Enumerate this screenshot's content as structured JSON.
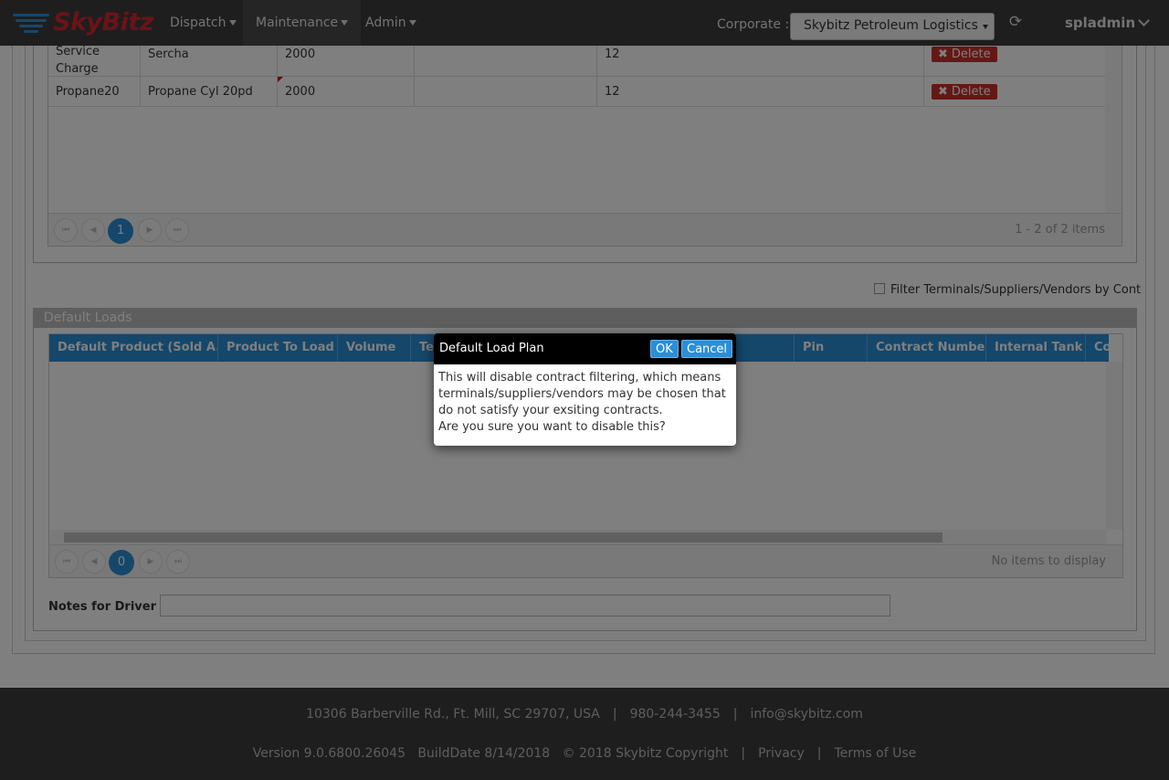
{
  "nav": {
    "logo": "SkyBitz",
    "menus": [
      {
        "label": "Dispatch"
      },
      {
        "label": "Maintenance"
      },
      {
        "label": "Admin"
      }
    ],
    "corporate_label": "Corporate :",
    "corporate_value": "Skybitz Petroleum Logistics",
    "user": "spladmin",
    "icons": {
      "refresh": "refresh-icon",
      "user_menu": "chevron-down-icon"
    }
  },
  "products_grid": {
    "rows": [
      {
        "code": "Service Charge",
        "name": "Sercha",
        "volume": "2000",
        "col4": "",
        "col5": "12",
        "action": "Delete"
      },
      {
        "code": "Propane20",
        "name": "Propane Cyl 20pd",
        "volume": "2000",
        "col4": "",
        "col5": "12",
        "action": "Delete"
      }
    ],
    "pager": {
      "page": "1",
      "info": "1 - 2 of 2 items"
    }
  },
  "filter": {
    "label": "Filter Terminals/Suppliers/Vendors by Cont",
    "checked": false
  },
  "default_loads": {
    "title": "Default Loads",
    "columns": [
      "Default Product (Sold A...",
      "Product To Load",
      "Volume",
      "Te",
      "Pin",
      "Contract Number",
      "Internal Tank",
      "Co"
    ],
    "pager": {
      "page": "0",
      "info": "No items to display"
    },
    "notes_label": "Notes for Driver",
    "notes_value": ""
  },
  "footer": {
    "address": "10306 Barberville Rd., Ft. Mill, SC 29707, USA",
    "phone": "980-244-3455",
    "email": "info@skybitz.com",
    "version": "Version 9.0.6800.26045",
    "build": "BuildDate 8/14/2018",
    "copyright": "© 2018 Skybitz Copyright",
    "privacy": "Privacy",
    "terms": "Terms of Use"
  },
  "dialog": {
    "title": "Default Load Plan",
    "ok": "OK",
    "cancel": "Cancel",
    "message_lines": [
      "This will disable contract filtering, which means",
      "terminals/suppliers/vendors may be chosen that",
      "do not satisfy your exsiting contracts.",
      "Are you sure you want to disable this?"
    ]
  },
  "colors": {
    "nav_bg": "#3d3d3d",
    "accent": "#2a8fd6",
    "delete": "#c9302c",
    "logo_red": "#d7262e"
  }
}
